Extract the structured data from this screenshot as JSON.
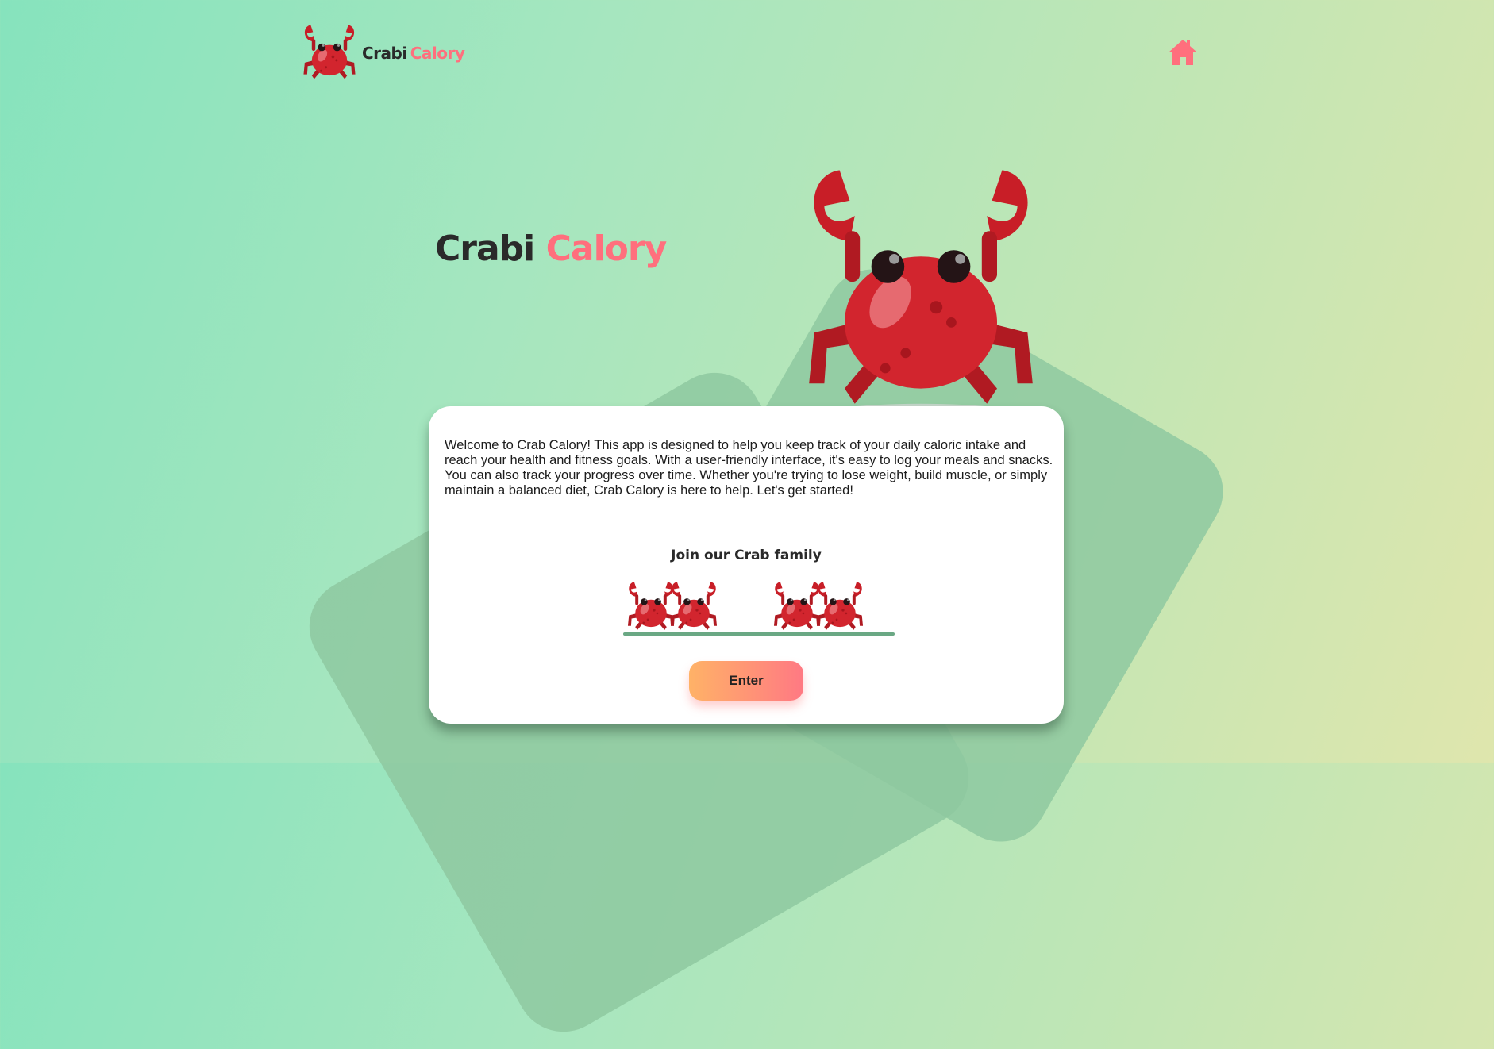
{
  "brand": {
    "name_part1": "Crabi",
    "name_part2": "Calory"
  },
  "nav": {
    "home_icon": "home-icon"
  },
  "hero": {
    "title_part1": "Crabi",
    "title_part2": "Calory"
  },
  "card": {
    "description": "Welcome to Crab Calory! This app is designed to help you keep track of your daily caloric intake and reach your health and fitness goals. With a user-friendly interface, it's easy to log your meals and snacks. You can also track your progress over time. Whether you're trying to lose weight, build muscle, or simply maintain a balanced diet, Crab Calory is here to help. Let's get started!",
    "join_heading": "Join our Crab family",
    "enter_label": "Enter"
  },
  "colors": {
    "accent_pink": "#ff6f7d",
    "crab_red": "#cc1f28",
    "button_start": "#ffb267",
    "button_end": "#ff7983"
  }
}
